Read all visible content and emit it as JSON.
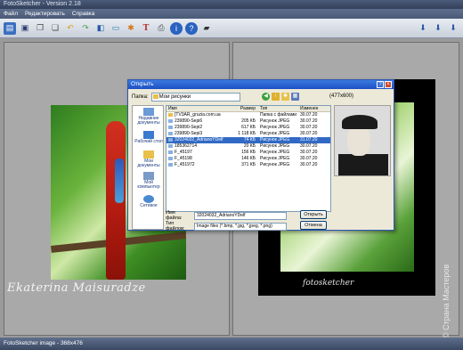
{
  "window": {
    "title": "FotoSketcher - Version 2.18"
  },
  "menu": [
    "Файл",
    "Редактировать",
    "Справка"
  ],
  "toolbar": {
    "icons": [
      "open-icon",
      "save-icon",
      "copy-icon",
      "paste-icon",
      "undo-icon",
      "redo-icon",
      "compare-icon",
      "picture-icon",
      "effects-icon",
      "text-icon",
      "print-icon",
      "info-icon",
      "help-icon",
      "chat-icon"
    ],
    "right_icons": [
      "zoom-in-icon",
      "zoom-out-icon",
      "zoom-fit-icon"
    ]
  },
  "dialog": {
    "title": "Открыть",
    "lookin_label": "Папка:",
    "lookin_value": "Мои рисунки",
    "preview_size": "(477x600)",
    "places": [
      {
        "label": "Недавние документы",
        "icon": "recent-icon"
      },
      {
        "label": "Рабочий стол",
        "icon": "desktop-icon"
      },
      {
        "label": "Мои документы",
        "icon": "my-documents-icon"
      },
      {
        "label": "Мой компьютер",
        "icon": "my-computer-icon"
      },
      {
        "label": "Сетевое",
        "icon": "network-icon"
      }
    ],
    "columns": {
      "name": "Имя",
      "size": "Размер",
      "type": "Тип",
      "date": "Изменен"
    },
    "files": [
      {
        "name": "[TV3AR_gruzia.com.ua",
        "size": "",
        "type": "Папка с файлами",
        "date": "30.07.20",
        "selected": false,
        "folder": true
      },
      {
        "name": "239890-Sepi6",
        "size": "205 КБ",
        "type": "Рисунок JPEG",
        "date": "30.07.20",
        "selected": false,
        "folder": false
      },
      {
        "name": "239890-Sepi2",
        "size": "617 КБ",
        "type": "Рисунок JPEG",
        "date": "30.07.20",
        "selected": false,
        "folder": false
      },
      {
        "name": "239890-Sepi3",
        "size": "1 118 КБ",
        "type": "Рисунок JPEG",
        "date": "30.07.20",
        "selected": false,
        "folder": false
      },
      {
        "name": "32024032_AdrianoYDelf",
        "size": "74 КБ",
        "type": "Рисунок JPEG",
        "date": "31.07.20",
        "selected": true,
        "folder": false
      },
      {
        "name": "185362714",
        "size": "20 КБ",
        "type": "Рисунок JPEG",
        "date": "30.07.20",
        "selected": false,
        "folder": false
      },
      {
        "name": "F_45197",
        "size": "156 КБ",
        "type": "Рисунок JPEG",
        "date": "30.07.20",
        "selected": false,
        "folder": false
      },
      {
        "name": "F_45198",
        "size": "146 КБ",
        "type": "Рисунок JPEG",
        "date": "30.07.20",
        "selected": false,
        "folder": false
      },
      {
        "name": "F_451972",
        "size": "371 КБ",
        "type": "Рисунок JPEG",
        "date": "30.07.20",
        "selected": false,
        "folder": false
      }
    ],
    "filename_label": "Имя файла:",
    "filename_value": "32024032_AdrianoYDelf",
    "filetype_label": "Тип файлов:",
    "filetype_value": "Image files (*.bmp, *.jpg, *.jpeg, *.png)",
    "open_button": "Открыть",
    "cancel_button": "Отмена"
  },
  "canvas": {
    "signature": "fotosketcher",
    "watermark_left": "Ekaterina Maisuradze",
    "watermark_right": "© Страна Мастеров"
  },
  "status": {
    "text": "FotoSketcher image - 368x476"
  }
}
